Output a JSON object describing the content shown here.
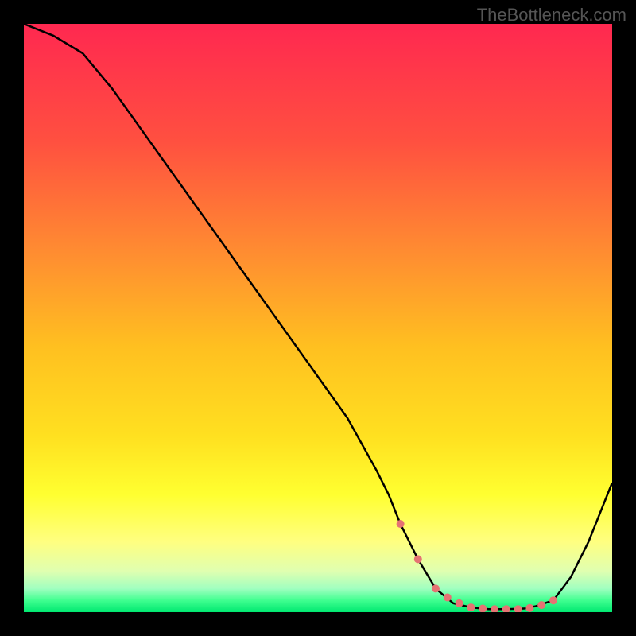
{
  "attribution": "TheBottleneck.com",
  "chart_data": {
    "type": "line",
    "title": "",
    "xlabel": "",
    "ylabel": "",
    "xlim": [
      0,
      100
    ],
    "ylim": [
      0,
      100
    ],
    "series": [
      {
        "name": "curve",
        "x": [
          0,
          5,
          10,
          15,
          20,
          25,
          30,
          35,
          40,
          45,
          50,
          55,
          60,
          62,
          64,
          67,
          70,
          73,
          76,
          79,
          82,
          85,
          87,
          90,
          93,
          96,
          100
        ],
        "y": [
          100,
          98,
          95,
          89,
          82,
          75,
          68,
          61,
          54,
          47,
          40,
          33,
          24,
          20,
          15,
          9,
          4,
          1.5,
          0.8,
          0.5,
          0.5,
          0.6,
          1,
          2,
          6,
          12,
          22
        ]
      },
      {
        "name": "markers",
        "x": [
          64,
          67,
          70,
          72,
          74,
          76,
          78,
          80,
          82,
          84,
          86,
          88,
          90
        ],
        "y": [
          15,
          9,
          4,
          2.5,
          1.5,
          0.8,
          0.6,
          0.5,
          0.5,
          0.5,
          0.7,
          1.2,
          2
        ]
      }
    ],
    "gradient": {
      "type": "vertical",
      "stops": [
        {
          "offset": 0,
          "color": "#ff2850"
        },
        {
          "offset": 20,
          "color": "#ff5040"
        },
        {
          "offset": 40,
          "color": "#ff9030"
        },
        {
          "offset": 55,
          "color": "#ffc020"
        },
        {
          "offset": 70,
          "color": "#ffe020"
        },
        {
          "offset": 80,
          "color": "#ffff30"
        },
        {
          "offset": 88,
          "color": "#ffff80"
        },
        {
          "offset": 93,
          "color": "#e0ffb0"
        },
        {
          "offset": 96,
          "color": "#a0ffc0"
        },
        {
          "offset": 98,
          "color": "#40ff90"
        },
        {
          "offset": 100,
          "color": "#00e870"
        }
      ]
    },
    "marker_color": "#e57373",
    "line_color": "#000000"
  }
}
